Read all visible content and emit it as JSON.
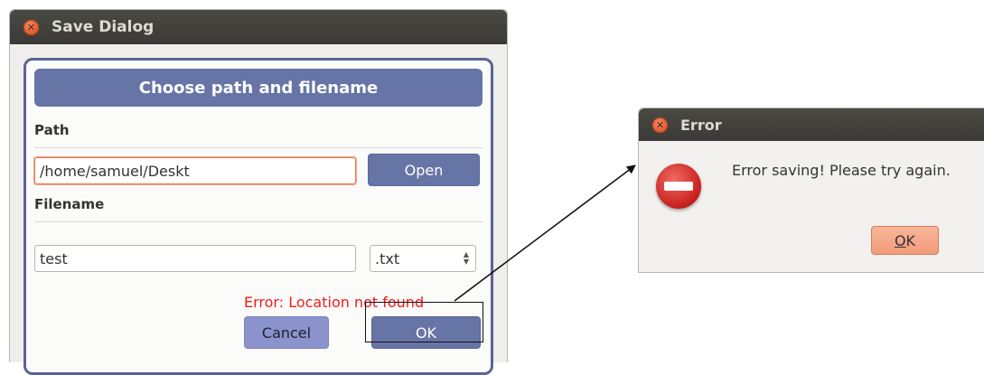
{
  "save_dialog": {
    "title": "Save Dialog",
    "header": "Choose path and filename",
    "path_label": "Path",
    "path_value": "/home/samuel/Deskt",
    "open_label": "Open",
    "filename_label": "Filename",
    "filename_value": "test",
    "extension_selected": ".txt",
    "error_message": "Error: Location not found",
    "cancel_label": "Cancel",
    "ok_label": "OK"
  },
  "error_dialog": {
    "title": "Error",
    "message": "Error saving! Please try again.",
    "ok_label_first": "O",
    "ok_label_rest": "K"
  },
  "colors": {
    "accent_blue": "#6674a6",
    "error_red": "#ef1d1d",
    "ok_orange": "#f29b79",
    "close_orange": "#e1562b"
  },
  "icons": [
    "close-icon",
    "error-stop-icon",
    "spin-arrows-icon"
  ]
}
